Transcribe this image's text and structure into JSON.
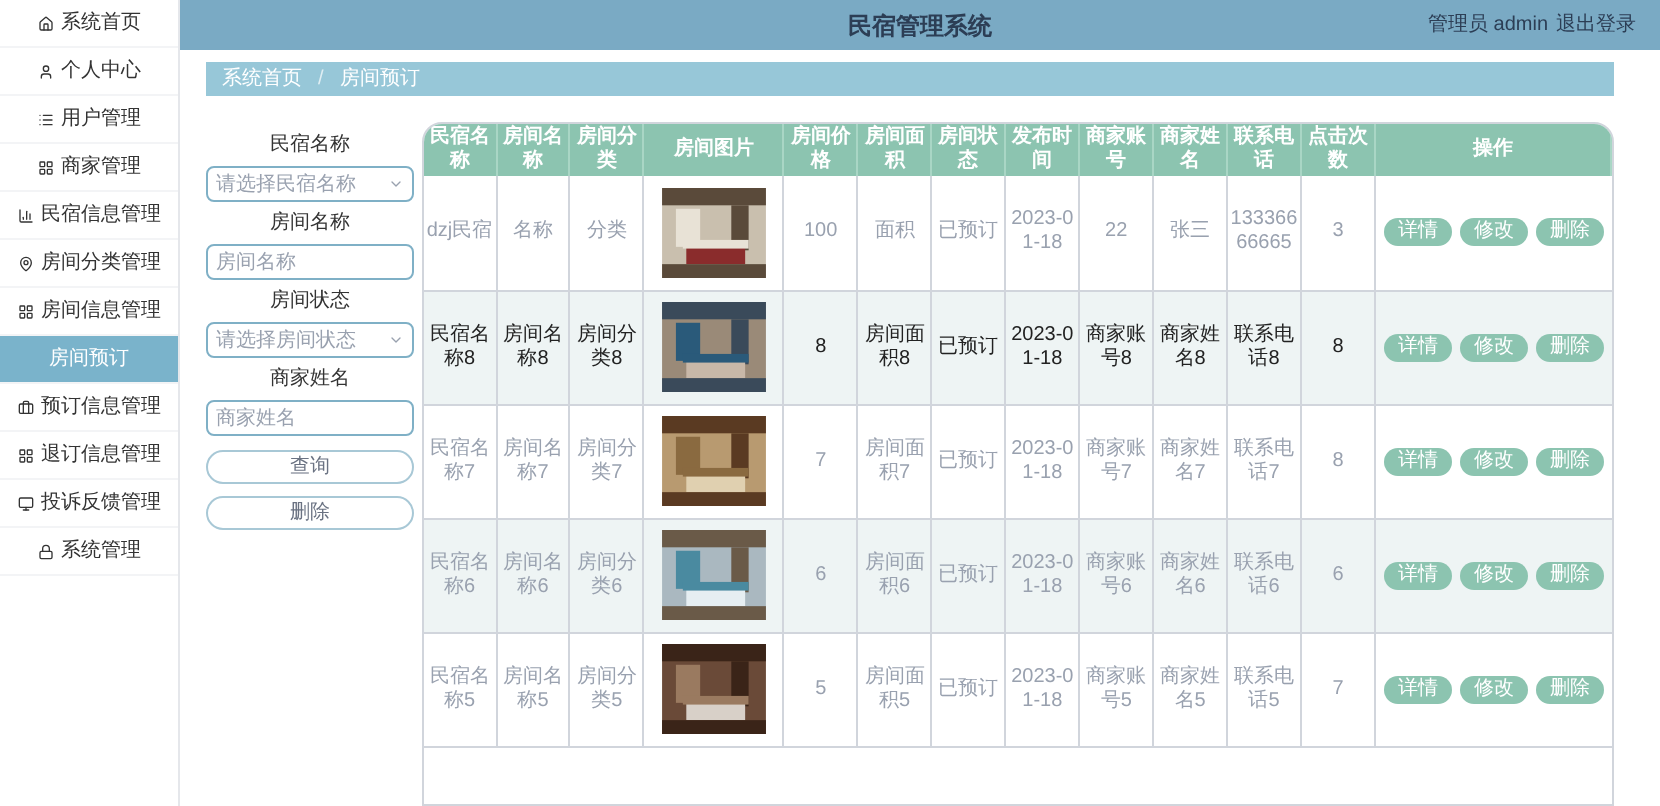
{
  "header": {
    "title": "民宿管理系统",
    "user": "管理员 admin",
    "logout": "退出登录"
  },
  "sidebar": {
    "items": [
      {
        "label": "系统首页",
        "selected": false
      },
      {
        "label": "个人中心",
        "selected": false
      },
      {
        "label": "用户管理",
        "selected": false
      },
      {
        "label": "商家管理",
        "selected": false
      },
      {
        "label": "民宿信息管理",
        "selected": false
      },
      {
        "label": "房间分类管理",
        "selected": false
      },
      {
        "label": "房间信息管理",
        "selected": false
      },
      {
        "label": "房间预订",
        "selected": true
      },
      {
        "label": "预订信息管理",
        "selected": false
      },
      {
        "label": "退订信息管理",
        "selected": false
      },
      {
        "label": "投诉反馈管理",
        "selected": false
      },
      {
        "label": "系统管理",
        "selected": false
      }
    ]
  },
  "breadcrumb": {
    "items": [
      "系统首页",
      "房间预订"
    ],
    "separator": "/"
  },
  "filters": [
    {
      "kind": "select",
      "label": "民宿名称",
      "placeholder": "请选择民宿名称"
    },
    {
      "kind": "input",
      "label": "房间名称",
      "placeholder": "房间名称"
    },
    {
      "kind": "select",
      "label": "房间状态",
      "placeholder": "请选择房间状态"
    },
    {
      "kind": "input",
      "label": "商家姓名",
      "placeholder": "商家姓名"
    }
  ],
  "filter_buttons": [
    "查询",
    "删除"
  ],
  "table": {
    "columns": [
      "民宿名称",
      "房间名称",
      "房间分类",
      "房间图片",
      "房间价格",
      "房间面积",
      "房间状态",
      "发布时间",
      "商家账号",
      "商家姓名",
      "联系电话",
      "点击次数",
      "操作"
    ],
    "rows": [
      {
        "hovered": false,
        "cells": [
          "dzj民宿",
          "名称",
          "分类",
          "",
          "100",
          "面积",
          "已预订",
          "2023-01-18",
          "22",
          "张三",
          "13336666665",
          "3"
        ],
        "actions": [
          "详情",
          "修改",
          "删除"
        ]
      },
      {
        "hovered": true,
        "cells": [
          "民宿名称8",
          "房间名称8",
          "房间分类8",
          "",
          "8",
          "房间面积8",
          "已预订",
          "2023-01-18",
          "商家账号8",
          "商家姓名8",
          "联系电话8",
          "8"
        ],
        "actions": [
          "详情",
          "修改",
          "删除"
        ]
      },
      {
        "hovered": false,
        "cells": [
          "民宿名称7",
          "房间名称7",
          "房间分类7",
          "",
          "7",
          "房间面积7",
          "已预订",
          "2023-01-18",
          "商家账号7",
          "商家姓名7",
          "联系电话7",
          "8"
        ],
        "actions": [
          "详情",
          "修改",
          "删除"
        ]
      },
      {
        "hovered": false,
        "cells": [
          "民宿名称6",
          "房间名称6",
          "房间分类6",
          "",
          "6",
          "房间面积6",
          "已预订",
          "2023-01-18",
          "商家账号6",
          "商家姓名6",
          "联系电话6",
          "6"
        ],
        "actions": [
          "详情",
          "修改",
          "删除"
        ]
      },
      {
        "hovered": false,
        "cells": [
          "民宿名称5",
          "房间名称5",
          "房间分类5",
          "",
          "5",
          "房间面积5",
          "已预订",
          "2023-01-18",
          "商家账号5",
          "商家姓名5",
          "联系电话5",
          "7"
        ],
        "actions": [
          "详情",
          "修改",
          "删除"
        ]
      }
    ]
  }
}
